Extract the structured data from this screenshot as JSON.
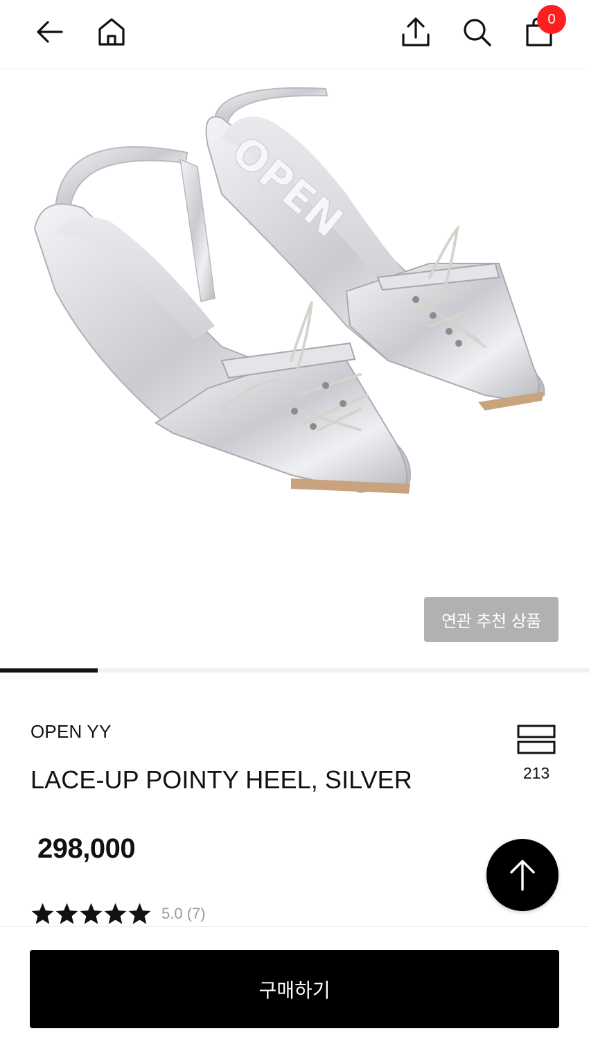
{
  "header": {
    "cart_count": "0",
    "icons": [
      "back-arrow-icon",
      "home-icon",
      "share-icon",
      "search-icon",
      "shopping-bag-icon"
    ]
  },
  "hero": {
    "sole_text": "OPEN",
    "related_button_label": "연관 추천 상품",
    "gallery_progress": 0.166
  },
  "product": {
    "brand": "OPEN YY",
    "name": "LACE-UP POINTY HEEL, SILVER",
    "price": "298,000",
    "like_count": "213",
    "rating_stars": 5,
    "rating_text": "5.0 (7)"
  },
  "bottom": {
    "buy_label": "구매하기"
  },
  "colors": {
    "badge": "#ff1f1f",
    "related_button": "#b1b1b1",
    "buy_button": "#000000",
    "silver": "#d9dadd"
  }
}
